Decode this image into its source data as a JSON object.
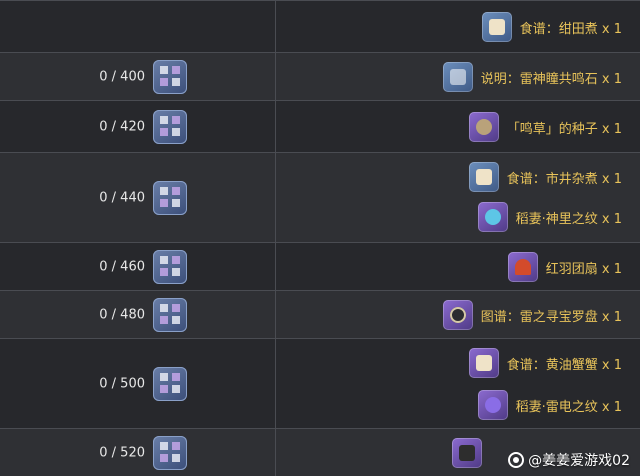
{
  "rows": [
    {
      "count": "",
      "rewards": [
        {
          "label": "食谱：绀田煮 x 1",
          "icon": "recipe-scroll-icon"
        }
      ]
    },
    {
      "count": "0 / 400",
      "rewards": [
        {
          "label": "说明：雷神瞳共鸣石 x 1",
          "icon": "instruction-scroll-icon"
        }
      ]
    },
    {
      "count": "0 / 420",
      "rewards": [
        {
          "label": "「鸣草」的种子 x 1",
          "icon": "seed-bag-icon"
        }
      ]
    },
    {
      "count": "0 / 440",
      "rewards": [
        {
          "label": "食谱：市井杂煮 x 1",
          "icon": "recipe-scroll-icon"
        },
        {
          "label": "稻妻·神里之纹 x 1",
          "icon": "kamisato-pattern-icon"
        }
      ]
    },
    {
      "count": "0 / 460",
      "rewards": [
        {
          "label": "红羽团扇 x 1",
          "icon": "red-feather-fan-icon"
        }
      ]
    },
    {
      "count": "0 / 480",
      "rewards": [
        {
          "label": "图谱：雷之寻宝罗盘 x 1",
          "icon": "compass-diagram-icon"
        }
      ]
    },
    {
      "count": "0 / 500",
      "rewards": [
        {
          "label": "食谱：黄油蟹蟹 x 1",
          "icon": "recipe-scroll-icon"
        },
        {
          "label": "稻妻·雷电之纹 x 1",
          "icon": "raiden-pattern-icon"
        }
      ]
    },
    {
      "count": "0 / 520",
      "rewards": [
        {
          "label": "",
          "icon": "weapon-item-icon"
        }
      ]
    }
  ],
  "watermark": "@姜姜爱游戏02"
}
